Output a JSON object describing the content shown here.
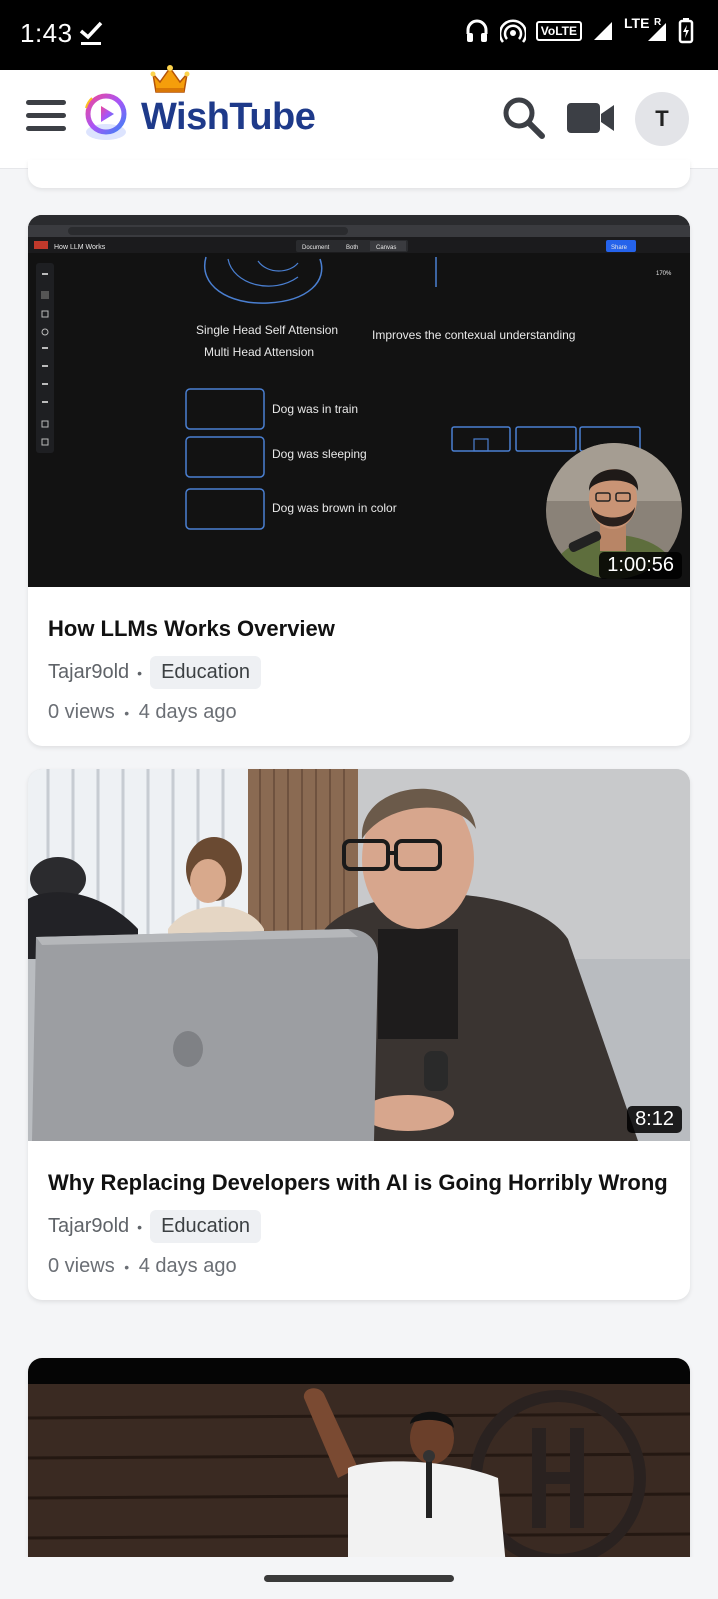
{
  "status_bar": {
    "time": "1:43",
    "network": "LTE",
    "volte": "VoLTE",
    "roaming": "R"
  },
  "header": {
    "brand": "WishTube",
    "avatar_initial": "T",
    "brand_color": "#1e3a8a"
  },
  "videos": [
    {
      "title": "How LLMs Works Overview",
      "channel": "Tajar9old",
      "category": "Education",
      "views": "0 views",
      "age": "4 days ago",
      "duration": "1:00:56",
      "thumbnail": {
        "doc_title": "How LLM Works",
        "tabs": [
          "Document",
          "Both",
          "Canvas"
        ],
        "share": "Share",
        "zoom": "170%",
        "lines": [
          "Single Head Self Attension",
          "Multi Head Attension",
          "Improves the contexual understanding",
          "Dog was in train",
          "Dog was sleeping",
          "Dog was brown in color"
        ]
      }
    },
    {
      "title": "Why Replacing Developers with AI is Going Horribly Wrong",
      "channel": "Tajar9old",
      "category": "Education",
      "views": "0 views",
      "age": "4 days ago",
      "duration": "8:12"
    },
    {
      "title": "",
      "duration": ""
    }
  ]
}
